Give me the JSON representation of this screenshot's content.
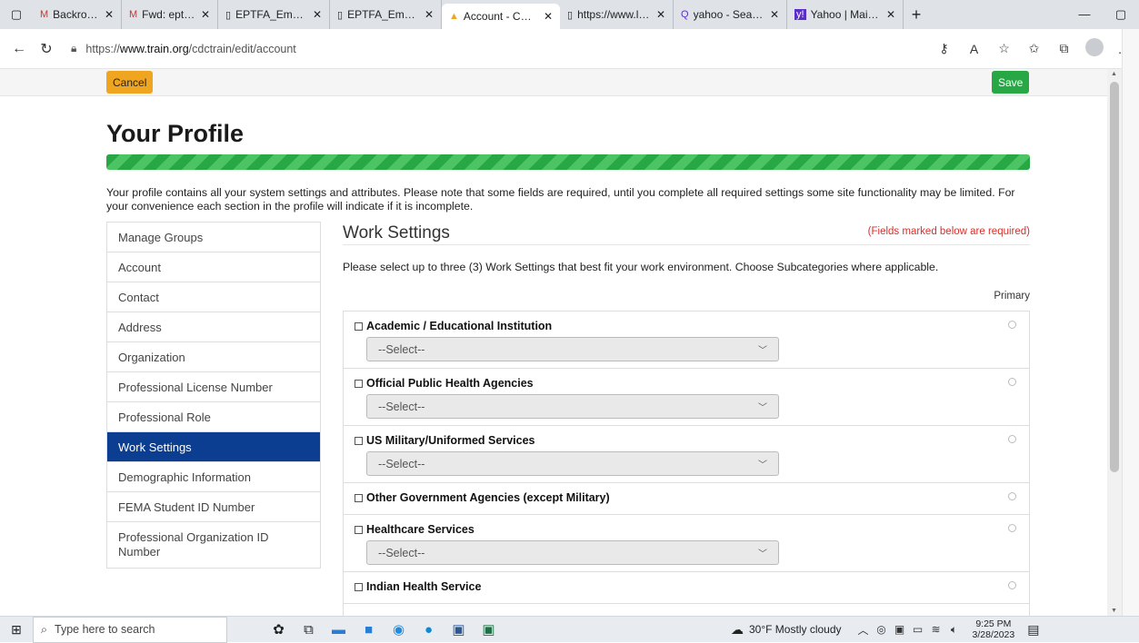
{
  "browser": {
    "tabs": [
      {
        "icon": "M",
        "title": "Backround screen",
        "active": false
      },
      {
        "icon": "M",
        "title": "Fwd: eptfa.org - M",
        "active": false
      },
      {
        "icon": "▯",
        "title": "EPTFA_Email.pdf",
        "active": false
      },
      {
        "icon": "▯",
        "title": "EPTFA_Email.pdf",
        "active": false
      },
      {
        "icon": "▲",
        "title": "Account - CDC TR",
        "active": true
      },
      {
        "icon": "▯",
        "title": "https://www.leag",
        "active": false
      },
      {
        "icon": "Q",
        "title": "yahoo - Search",
        "active": false
      },
      {
        "icon": "y!",
        "title": "Yahoo | Mail, Wea",
        "active": false
      }
    ],
    "url_prefix": "https://",
    "url_domain": "www.train.org",
    "url_path": "/cdctrain/edit/account"
  },
  "actions": {
    "cancel_label": "Cancel",
    "save_label": "Save"
  },
  "page": {
    "title": "Your Profile",
    "progress_percent": 100,
    "intro": "Your profile contains all your system settings and attributes. Please note that some fields are required, until you complete all required settings some site functionality may be limited. For your convenience each section in the profile will indicate if it is incomplete."
  },
  "sidebar": {
    "items": [
      {
        "label": "Manage Groups"
      },
      {
        "label": "Account"
      },
      {
        "label": "Contact"
      },
      {
        "label": "Address"
      },
      {
        "label": "Organization"
      },
      {
        "label": "Professional License Number"
      },
      {
        "label": "Professional Role"
      },
      {
        "label": "Work Settings"
      },
      {
        "label": "Demographic Information"
      },
      {
        "label": "FEMA Student ID Number"
      },
      {
        "label": "Professional Organization ID Number"
      }
    ]
  },
  "work_settings": {
    "title": "Work Settings",
    "required_note": "(Fields marked below are required)",
    "instructions": "Please select up to three (3) Work Settings that best fit your work environment. Choose Subcategories where applicable.",
    "primary_header": "Primary",
    "select_placeholder": "--Select--",
    "options": [
      {
        "label": "Academic / Educational Institution"
      },
      {
        "label": "Official Public Health Agencies"
      },
      {
        "label": "US Military/Uniformed Services"
      },
      {
        "label": "Other Government Agencies (except Military)"
      },
      {
        "label": "Healthcare Services"
      },
      {
        "label": "Indian Health Service"
      }
    ]
  },
  "taskbar": {
    "search_placeholder": "Type here to search",
    "weather": "30°F  Mostly cloudy",
    "time": "9:25 PM",
    "date": "3/28/2023"
  }
}
